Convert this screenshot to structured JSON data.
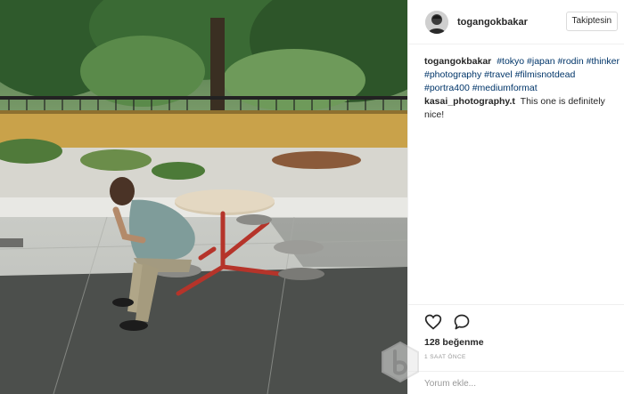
{
  "post": {
    "photo_alt": "Man sitting at a red outdoor table in a park",
    "header": {
      "username": "togangokbakar",
      "follow_label": "Takiptesin"
    },
    "caption": {
      "author": "togangokbakar",
      "hashtags": [
        "#tokyo",
        "#japan",
        "#rodin",
        "#thinker",
        "#photography",
        "#travel",
        "#filmisnotdead",
        "#portra400",
        "#mediumformat"
      ]
    },
    "comments": [
      {
        "author": "kasai_photography.t",
        "text": "This one is definitely nice!"
      }
    ],
    "likes": "128 beğenme",
    "time": "1 SAAT ÖNCE",
    "add_comment_placeholder": "Yorum ekle..."
  },
  "icons": {
    "like": "heart-icon",
    "comment": "comment-bubble-icon",
    "watermark": "watermark-logo-icon"
  },
  "colors": {
    "hashtag": "#003569",
    "table_red": "#b5342a"
  }
}
